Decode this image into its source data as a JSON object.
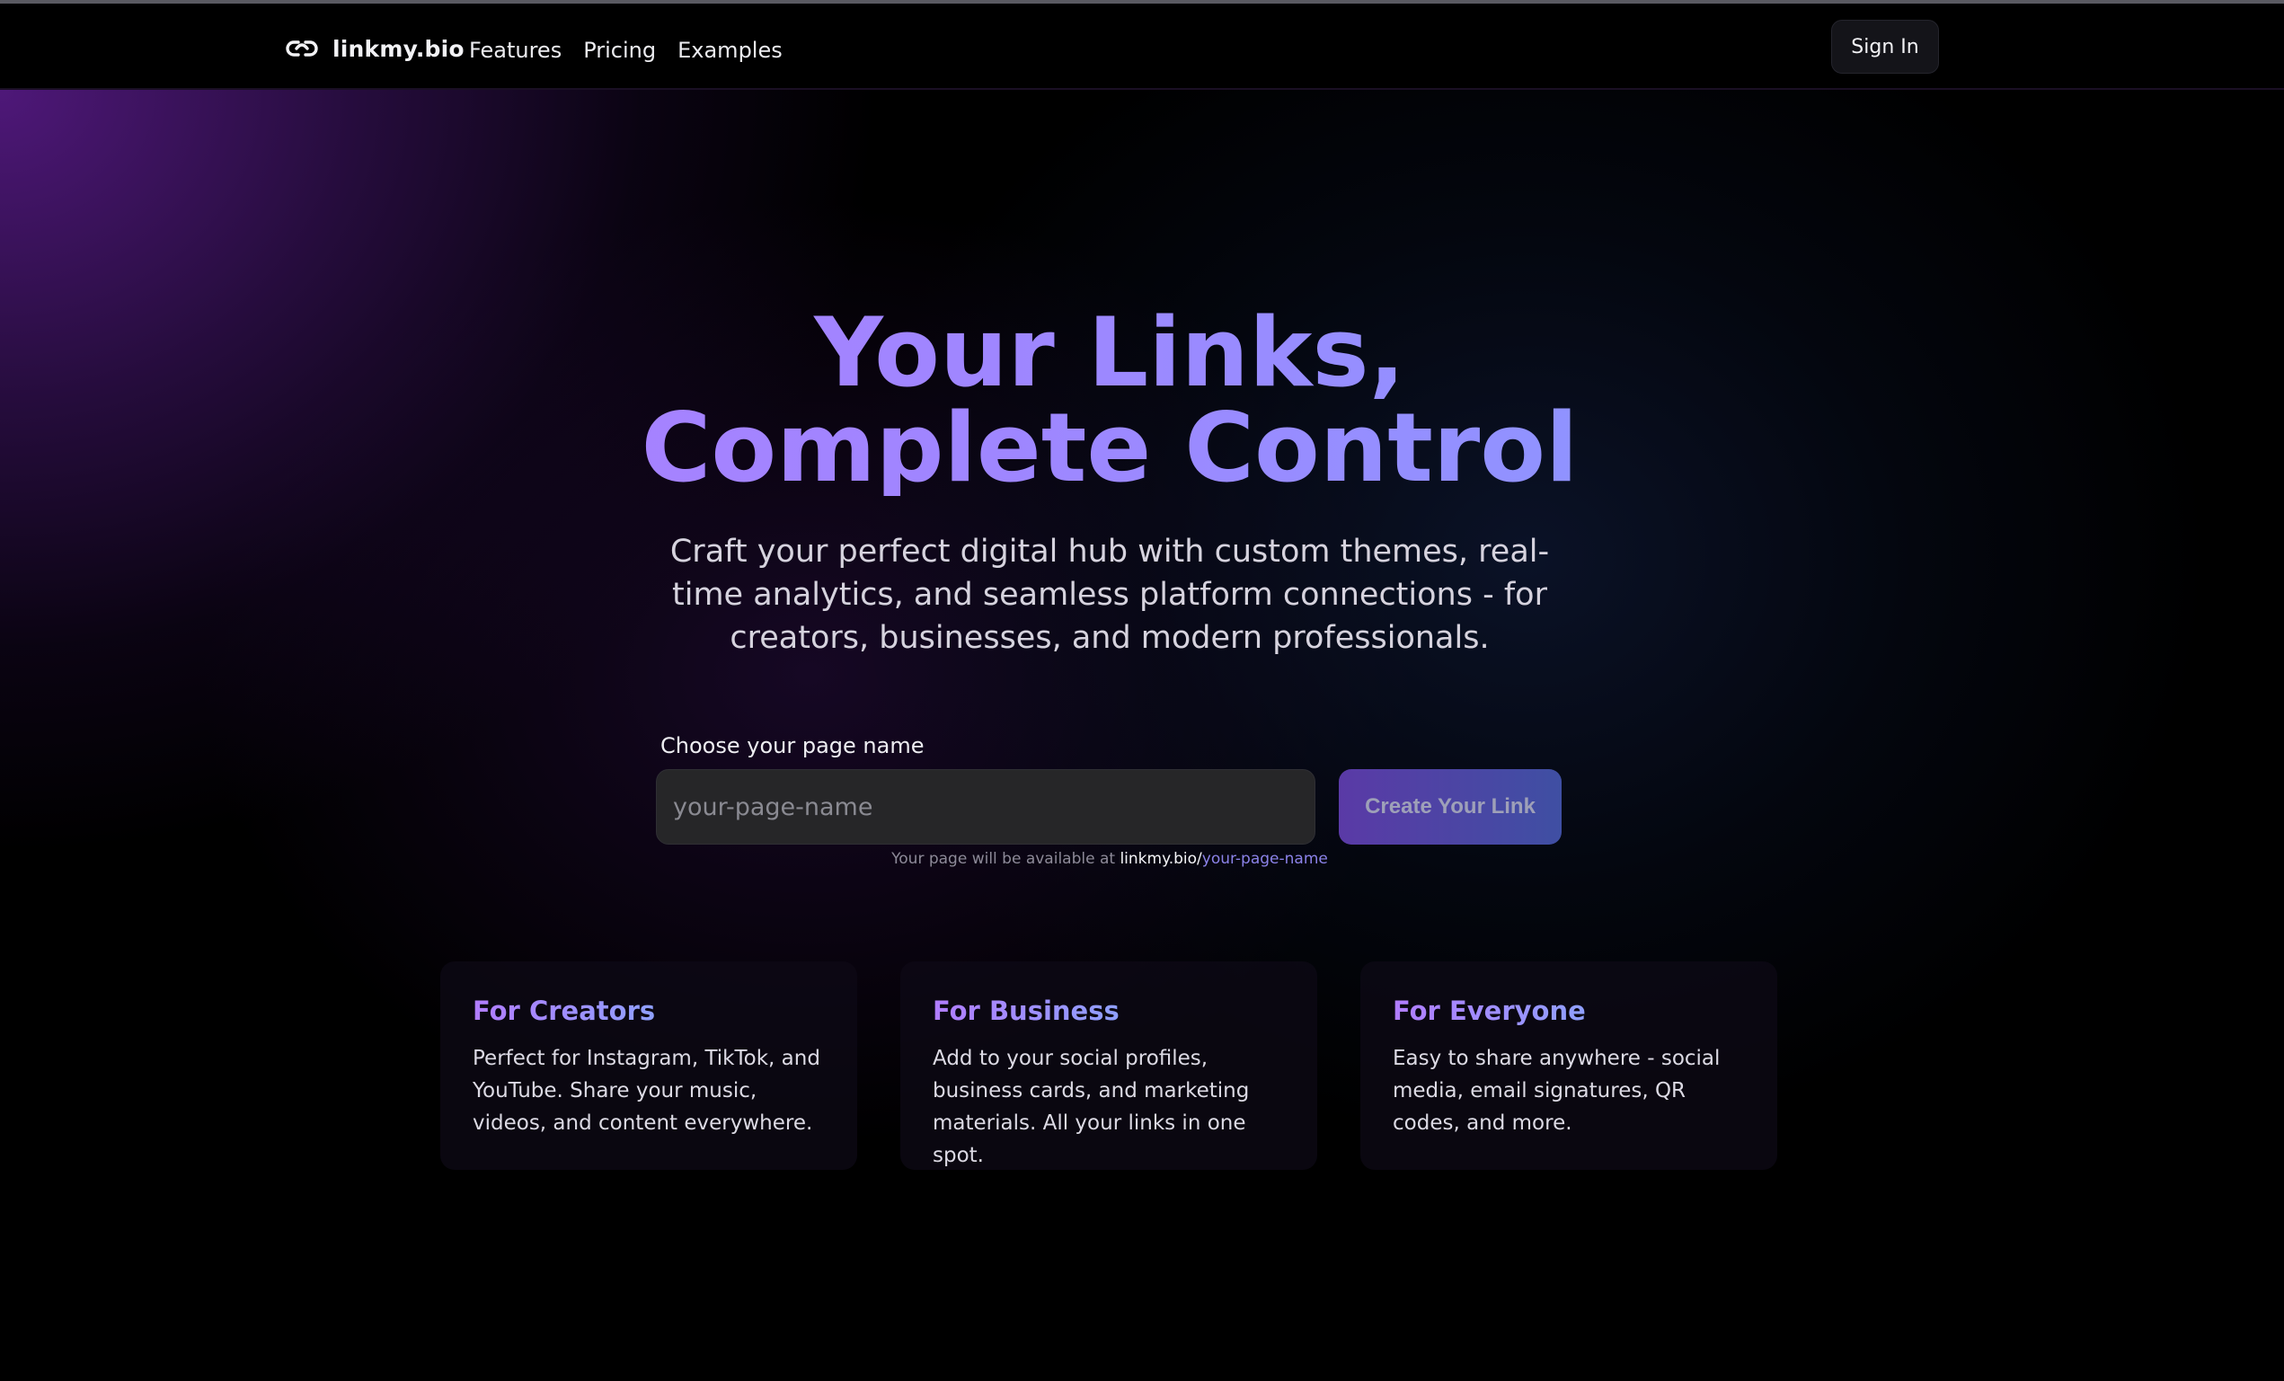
{
  "nav": {
    "brand": "linkmy.bio",
    "links": [
      {
        "label": "Features"
      },
      {
        "label": "Pricing"
      },
      {
        "label": "Examples"
      }
    ],
    "sign_in": "Sign In"
  },
  "hero": {
    "headline_line1": "Your Links,",
    "headline_line2": "Complete Control",
    "subhead": "Craft your perfect digital hub with custom themes, real-time analytics, and seamless platform connections - for creators, businesses, and modern professionals."
  },
  "signup": {
    "label": "Choose your page name",
    "placeholder": "your-page-name",
    "value": "",
    "button": "Create Your Link",
    "hint_prefix": "Your page will be available at ",
    "hint_domain": "linkmy.bio/",
    "hint_slug": "your-page-name"
  },
  "cards": [
    {
      "title": "For Creators",
      "text": "Perfect for Instagram, TikTok, and YouTube. Share your music, videos, and content everywhere."
    },
    {
      "title": "For Business",
      "text": "Add to your social profiles, business cards, and marketing materials. All your links in one spot."
    },
    {
      "title": "For Everyone",
      "text": "Easy to share anywhere - social media, email signatures, QR codes, and more."
    }
  ],
  "colors": {
    "background": "#000000",
    "accent_purple": "#b17cff",
    "accent_blue": "#7fa1ff",
    "button_start": "#5a3aa6",
    "button_end": "#3f4fa3",
    "slug_link": "#8b82e8"
  },
  "icons": {
    "brand": "link-icon"
  }
}
